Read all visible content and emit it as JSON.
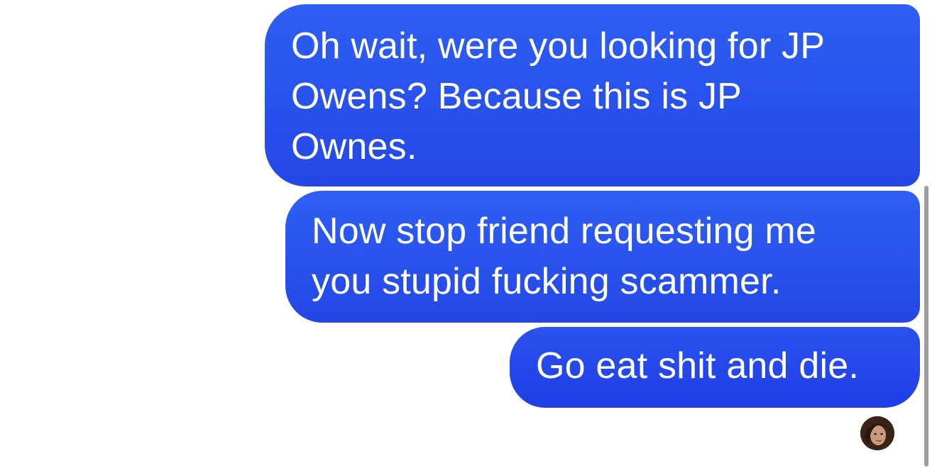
{
  "messages": [
    {
      "text": "Oh wait, were you looking for JP\nOwens? Because this is JP\nOwnes."
    },
    {
      "text": "Now stop friend requesting me\nyou stupid fucking scammer."
    },
    {
      "text": "Go eat shit and die."
    }
  ],
  "colors": {
    "bubble_top": "#2e5ff3",
    "bubble_bottom": "#2447e6",
    "scrollbar": "#9e9e9e"
  },
  "icons": {
    "read_receipt": "avatar-icon"
  }
}
